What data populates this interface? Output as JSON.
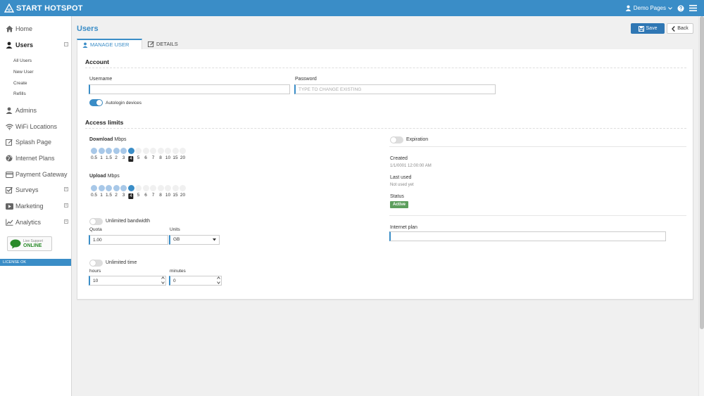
{
  "app": {
    "brand": "START HOTSPOT",
    "account_menu": "Demo Pages"
  },
  "sidebar": {
    "items": [
      {
        "label": "Home",
        "icon": "home-icon"
      },
      {
        "label": "Users",
        "icon": "user-icon"
      },
      {
        "label": "Admins",
        "icon": "user-icon"
      },
      {
        "label": "WiFi Locations",
        "icon": "wifi-icon"
      },
      {
        "label": "Splash Page",
        "icon": "edit-icon"
      },
      {
        "label": "Internet Plans",
        "icon": "globe-icon"
      },
      {
        "label": "Payment Gateway",
        "icon": "credit-card-icon"
      },
      {
        "label": "Surveys",
        "icon": "checkbox-icon"
      },
      {
        "label": "Marketing",
        "icon": "play-icon"
      },
      {
        "label": "Analytics",
        "icon": "chart-icon"
      }
    ],
    "users_submenu": [
      "All Users",
      "New User",
      "Create",
      "Refills"
    ],
    "live_support": {
      "label": "Live Support",
      "status": "ONLINE"
    },
    "license": "LICENSE OK"
  },
  "page": {
    "title": "Users",
    "save_label": "Save",
    "back_label": "Back"
  },
  "tabs": [
    {
      "label": "MANAGE USER",
      "active": true
    },
    {
      "label": "DETAILS",
      "active": false
    }
  ],
  "account": {
    "title": "Account",
    "username_label": "Username",
    "username_value": "",
    "password_label": "Password",
    "password_placeholder": "TYPE TO CHANGE EXISTING",
    "autologin_label": "Autologin devices",
    "autologin_on": true
  },
  "access_limits": {
    "title": "Access limits",
    "download_label": "Download",
    "upload_label": "Upload",
    "unit": "Mbps",
    "speed_steps": [
      "0.5",
      "1",
      "1.5",
      "2",
      "3",
      "4",
      "5",
      "6",
      "7",
      "8",
      "10",
      "15",
      "20"
    ],
    "download_value": "4",
    "upload_value": "4",
    "unlimited_bandwidth_label": "Unlimited bandwidth",
    "unlimited_bandwidth_on": false,
    "quota_label": "Quota",
    "quota_value": "1.00",
    "units_label": "Units",
    "units_value": "GB",
    "unlimited_time_label": "Unlimited time",
    "unlimited_time_on": false,
    "hours_label": "hours",
    "hours_value": "10",
    "minutes_label": "minutes",
    "minutes_value": "0"
  },
  "info": {
    "expiration_label": "Expiration",
    "expiration_on": false,
    "created_label": "Created",
    "created_value": "1/1/0001 12:00:00 AM",
    "last_used_label": "Last used",
    "last_used_value": "Not used yet",
    "status_label": "Status",
    "status_value": "Active",
    "internet_plan_label": "Internet plan",
    "internet_plan_value": ""
  },
  "colors": {
    "accent": "#3a8dc7",
    "save_button": "#2f77b4",
    "status_active": "#5c9e5c"
  }
}
